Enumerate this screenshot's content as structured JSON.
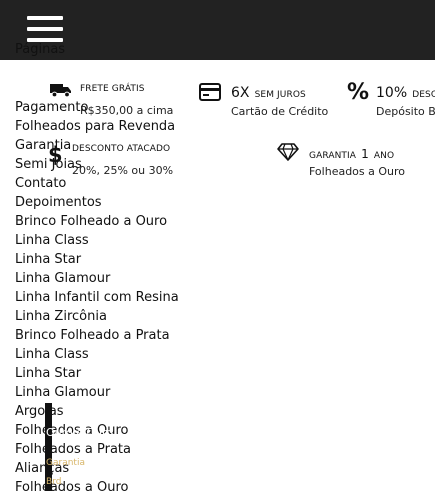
{
  "header": {
    "menu_icon": "hamburger-icon"
  },
  "menu": {
    "heading": "Páginas",
    "items": [
      "Pagamento",
      "Folheados para Revenda",
      "Garantia",
      "Semi Joias",
      "Contato",
      "Depoimentos",
      "Brinco Folheado a Ouro",
      "Linha Class",
      "Linha Star",
      "Linha Glamour",
      "Linha Infantil com Resina",
      "Linha Zircônia",
      "Brinco Folheado a Prata",
      "Linha Class",
      "Linha Star",
      "Linha Glamour",
      "Argolas",
      "Folheados a Ouro",
      "Folheados a Prata",
      "Alianças",
      "Folheados a Ouro"
    ]
  },
  "features": {
    "frete": {
      "icon": "truck-icon",
      "title": "Frete grátis",
      "sub": "R$350,00 a cima"
    },
    "parcelas": {
      "icon": "credit-card-icon",
      "big": "6X",
      "small": "sem juros",
      "sub": "Cartão de Crédito"
    },
    "desconto_pct": {
      "icon": "percent-icon",
      "big": "10%",
      "small": "desco",
      "sub": "Depósito Ba"
    },
    "atacado": {
      "icon": "dollar-icon",
      "glyph": "$",
      "title": "Desconto Atacado",
      "sub": "20%, 25% ou 30%"
    },
    "garantia": {
      "icon": "diamond-icon",
      "title": "Garantia",
      "big": "1",
      "small": "ano",
      "sub": "Folheados a Ouro"
    }
  },
  "footer_overlay": {
    "white_text": "Ouro e Ouro",
    "gold1": "Garantia",
    "gold2": "Brd"
  }
}
